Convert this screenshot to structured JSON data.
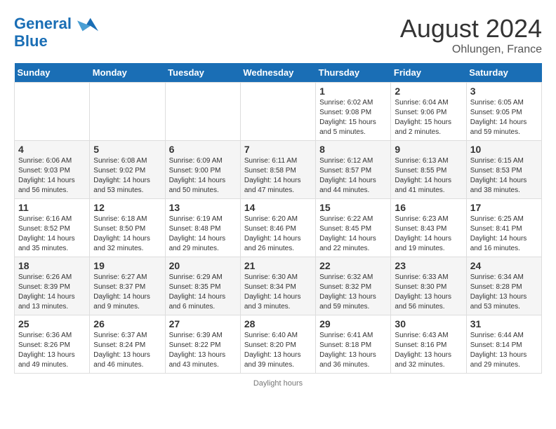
{
  "header": {
    "logo_line1": "General",
    "logo_line2": "Blue",
    "main_title": "August 2024",
    "subtitle": "Ohlungen, France"
  },
  "footer": {
    "note": "Daylight hours"
  },
  "calendar": {
    "days_of_week": [
      "Sunday",
      "Monday",
      "Tuesday",
      "Wednesday",
      "Thursday",
      "Friday",
      "Saturday"
    ],
    "weeks": [
      [
        {
          "day": "",
          "info": ""
        },
        {
          "day": "",
          "info": ""
        },
        {
          "day": "",
          "info": ""
        },
        {
          "day": "",
          "info": ""
        },
        {
          "day": "1",
          "info": "Sunrise: 6:02 AM\nSunset: 9:08 PM\nDaylight: 15 hours\nand 5 minutes."
        },
        {
          "day": "2",
          "info": "Sunrise: 6:04 AM\nSunset: 9:06 PM\nDaylight: 15 hours\nand 2 minutes."
        },
        {
          "day": "3",
          "info": "Sunrise: 6:05 AM\nSunset: 9:05 PM\nDaylight: 14 hours\nand 59 minutes."
        }
      ],
      [
        {
          "day": "4",
          "info": "Sunrise: 6:06 AM\nSunset: 9:03 PM\nDaylight: 14 hours\nand 56 minutes."
        },
        {
          "day": "5",
          "info": "Sunrise: 6:08 AM\nSunset: 9:02 PM\nDaylight: 14 hours\nand 53 minutes."
        },
        {
          "day": "6",
          "info": "Sunrise: 6:09 AM\nSunset: 9:00 PM\nDaylight: 14 hours\nand 50 minutes."
        },
        {
          "day": "7",
          "info": "Sunrise: 6:11 AM\nSunset: 8:58 PM\nDaylight: 14 hours\nand 47 minutes."
        },
        {
          "day": "8",
          "info": "Sunrise: 6:12 AM\nSunset: 8:57 PM\nDaylight: 14 hours\nand 44 minutes."
        },
        {
          "day": "9",
          "info": "Sunrise: 6:13 AM\nSunset: 8:55 PM\nDaylight: 14 hours\nand 41 minutes."
        },
        {
          "day": "10",
          "info": "Sunrise: 6:15 AM\nSunset: 8:53 PM\nDaylight: 14 hours\nand 38 minutes."
        }
      ],
      [
        {
          "day": "11",
          "info": "Sunrise: 6:16 AM\nSunset: 8:52 PM\nDaylight: 14 hours\nand 35 minutes."
        },
        {
          "day": "12",
          "info": "Sunrise: 6:18 AM\nSunset: 8:50 PM\nDaylight: 14 hours\nand 32 minutes."
        },
        {
          "day": "13",
          "info": "Sunrise: 6:19 AM\nSunset: 8:48 PM\nDaylight: 14 hours\nand 29 minutes."
        },
        {
          "day": "14",
          "info": "Sunrise: 6:20 AM\nSunset: 8:46 PM\nDaylight: 14 hours\nand 26 minutes."
        },
        {
          "day": "15",
          "info": "Sunrise: 6:22 AM\nSunset: 8:45 PM\nDaylight: 14 hours\nand 22 minutes."
        },
        {
          "day": "16",
          "info": "Sunrise: 6:23 AM\nSunset: 8:43 PM\nDaylight: 14 hours\nand 19 minutes."
        },
        {
          "day": "17",
          "info": "Sunrise: 6:25 AM\nSunset: 8:41 PM\nDaylight: 14 hours\nand 16 minutes."
        }
      ],
      [
        {
          "day": "18",
          "info": "Sunrise: 6:26 AM\nSunset: 8:39 PM\nDaylight: 14 hours\nand 13 minutes."
        },
        {
          "day": "19",
          "info": "Sunrise: 6:27 AM\nSunset: 8:37 PM\nDaylight: 14 hours\nand 9 minutes."
        },
        {
          "day": "20",
          "info": "Sunrise: 6:29 AM\nSunset: 8:35 PM\nDaylight: 14 hours\nand 6 minutes."
        },
        {
          "day": "21",
          "info": "Sunrise: 6:30 AM\nSunset: 8:34 PM\nDaylight: 14 hours\nand 3 minutes."
        },
        {
          "day": "22",
          "info": "Sunrise: 6:32 AM\nSunset: 8:32 PM\nDaylight: 13 hours\nand 59 minutes."
        },
        {
          "day": "23",
          "info": "Sunrise: 6:33 AM\nSunset: 8:30 PM\nDaylight: 13 hours\nand 56 minutes."
        },
        {
          "day": "24",
          "info": "Sunrise: 6:34 AM\nSunset: 8:28 PM\nDaylight: 13 hours\nand 53 minutes."
        }
      ],
      [
        {
          "day": "25",
          "info": "Sunrise: 6:36 AM\nSunset: 8:26 PM\nDaylight: 13 hours\nand 49 minutes."
        },
        {
          "day": "26",
          "info": "Sunrise: 6:37 AM\nSunset: 8:24 PM\nDaylight: 13 hours\nand 46 minutes."
        },
        {
          "day": "27",
          "info": "Sunrise: 6:39 AM\nSunset: 8:22 PM\nDaylight: 13 hours\nand 43 minutes."
        },
        {
          "day": "28",
          "info": "Sunrise: 6:40 AM\nSunset: 8:20 PM\nDaylight: 13 hours\nand 39 minutes."
        },
        {
          "day": "29",
          "info": "Sunrise: 6:41 AM\nSunset: 8:18 PM\nDaylight: 13 hours\nand 36 minutes."
        },
        {
          "day": "30",
          "info": "Sunrise: 6:43 AM\nSunset: 8:16 PM\nDaylight: 13 hours\nand 32 minutes."
        },
        {
          "day": "31",
          "info": "Sunrise: 6:44 AM\nSunset: 8:14 PM\nDaylight: 13 hours\nand 29 minutes."
        }
      ]
    ]
  }
}
